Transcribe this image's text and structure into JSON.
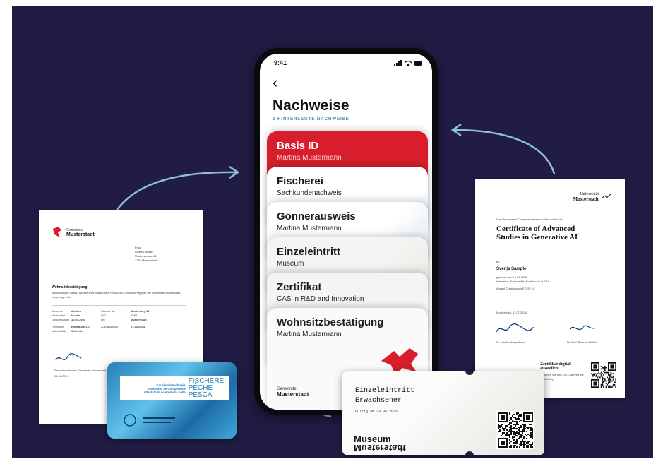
{
  "colors": {
    "background": "#211c44",
    "accent_red": "#d81e2c",
    "arrow": "#8fbfd6"
  },
  "phone": {
    "time": "9:41",
    "status_icons": "signal wifi battery",
    "back_label": "‹",
    "title": "Nachweise",
    "subtitle": "3 HINTERLEGTE NACHWEISE",
    "cards": [
      {
        "title": "Basis ID",
        "subtitle": "Martina Mustermann"
      },
      {
        "title": "Fischerei",
        "subtitle": "Sachkundenachweis"
      },
      {
        "title": "Gönnerausweis",
        "subtitle": "Martina Mustermann"
      },
      {
        "title": "Einzeleintritt",
        "subtitle": "Museum"
      },
      {
        "title": "Zertifikat",
        "subtitle": "CAS in R&D and Innovation"
      },
      {
        "title": "Wohnsitzbestätigung",
        "subtitle": "Martina Mustermann"
      }
    ],
    "footer_small": "Gemeinde",
    "footer_big": "Musterstadt"
  },
  "left_doc": {
    "org_small": "Gemeinde",
    "org_big": "Musterstadt",
    "address": [
      "Frau",
      "Andrea Muster",
      "Musterstrasse 12",
      "1234 Musterstadt"
    ],
    "heading": "Wohnsitzbestätigung",
    "intro": "Wir bestätigen, dass nachstehend aufgeführte Person im Einwohnerregister der Gemeinde Musterstadt eingetragen ist:",
    "rows": [
      [
        "Vorname",
        "Andrea",
        "Strasse Nr.",
        "Musterweg 14"
      ],
      [
        "Nachname",
        "Muster",
        "PLZ",
        "1234"
      ],
      [
        "Geburtsdatum",
        "12.04.2001",
        "Ort",
        "Musterstadt"
      ],
      [
        "Heimatort",
        "Entlebuch LU",
        "Zuzugsdatum",
        "01.04.2024"
      ],
      [
        "Nationalität",
        "Schweiz",
        "",
        ""
      ]
    ],
    "footer": "Einwohnerdienste Gemeinde Musterstadt",
    "date": "06.12.2024"
  },
  "fish_card": {
    "line1": "Sachkundenachweis",
    "line2": "Attestation de Compétence",
    "line3": "Attestato di competenza nella",
    "big1": "FISCHEREI",
    "big2": "PÊCHE",
    "big3": "PESCA"
  },
  "right_doc": {
    "uni_small": "Universität",
    "uni_big": "Musterstadt",
    "intro": "Das Department Computerwissenschaften erteilt das",
    "title": "Certificate of Advanced Studies in Generative AI",
    "to": "an",
    "name": "Svenja Sample",
    "details": [
      "geboren am: 10.08.1998",
      "Heimatort, Nationalität: Entlebuch LU, CH",
      "",
      "Anzahl Credits nach ETCS: 10"
    ],
    "place_date": "Musterstadt, 11.07.2024",
    "sign1": "Dr. Martina Meyerhans",
    "sign2": "Dr. Prof. Barbara Müller",
    "cta_title": "Zertifikat digital ausstellen!",
    "cta_text": "Scannen Sie den QR-Code mit der Wallet-App."
  },
  "ticket": {
    "title": "Einzeleintritt",
    "category": "Erwachsener",
    "valid": "Gültig am 23.04.2025",
    "brand1": "Museum",
    "brand2": "Musterstadt"
  }
}
